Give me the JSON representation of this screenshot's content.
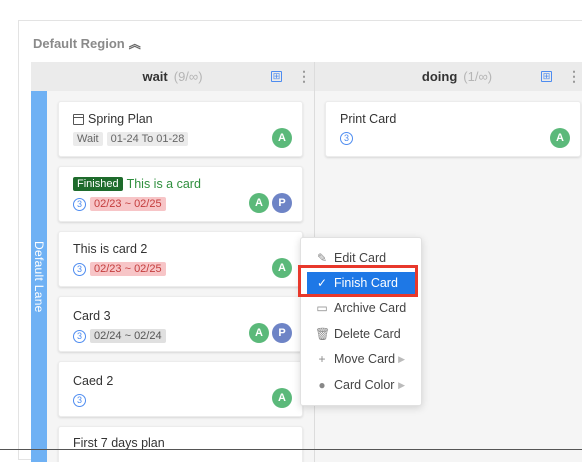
{
  "region": {
    "title": "Default Region",
    "collapse_icon": "double-chevron-up-icon"
  },
  "columns": [
    {
      "title": "wait",
      "count": "(9/∞)",
      "add_icon": "⊞",
      "more_icon": "⋮"
    },
    {
      "title": "doing",
      "count": "(1/∞)",
      "add_icon": "⊞",
      "more_icon": "⋮"
    }
  ],
  "lane": {
    "label": "Default Lane"
  },
  "cards": [
    {
      "title": "Spring Plan",
      "status": "Wait",
      "dates": "01-24 To 01-28",
      "avatars": [
        "A"
      ]
    },
    {
      "badge": "Finished",
      "title": "This is a card",
      "num": "3",
      "dates": "02/23 ~ 02/25",
      "avatars": [
        "A",
        "P"
      ]
    },
    {
      "title": "This is card 2",
      "num": "3",
      "dates": "02/23 ~ 02/25",
      "avatars": [
        "A"
      ]
    },
    {
      "title": "Card 3",
      "num": "3",
      "dates": "02/24 ~ 02/24",
      "avatars": [
        "A",
        "P"
      ]
    },
    {
      "title": "Caed 2",
      "num": "3",
      "avatars": [
        "A"
      ]
    },
    {
      "title": "First 7 days plan"
    }
  ],
  "doing_cards": [
    {
      "title": "Print Card",
      "num": "3",
      "avatars": [
        "A"
      ]
    }
  ],
  "context_menu": {
    "items": [
      {
        "label": "Edit Card",
        "icon": "edit-icon"
      },
      {
        "label": "Finish Card",
        "icon": "check-circle-icon",
        "active": true
      },
      {
        "label": "Archive Card",
        "icon": "archive-icon"
      },
      {
        "label": "Delete Card",
        "icon": "trash-icon"
      },
      {
        "label": "Move Card",
        "icon": "move-icon",
        "submenu": true
      },
      {
        "label": "Card Color",
        "icon": "palette-icon",
        "submenu": true
      }
    ]
  },
  "colors": {
    "avatar_a": "#5bb97a",
    "avatar_p": "#6e84c6",
    "lane": "#6fb1f4",
    "menu_active": "#1e78e6",
    "highlight": "#e8382b"
  }
}
